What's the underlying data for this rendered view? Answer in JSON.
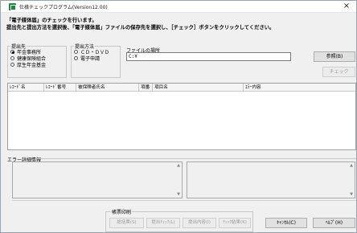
{
  "window": {
    "title": "仕様チェックプログラム(Version12.00)",
    "close_glyph": "×"
  },
  "messages": {
    "line1": "「電子媒体届」のチェックを行います。",
    "line2": "提出先と提出方法を選択後、「電子媒体届」ファイルの保存先を選択し、［チェック］ボタンをクリックしてください。"
  },
  "destination": {
    "legend": "提出先",
    "options": [
      {
        "label": "年金事務所",
        "selected": true
      },
      {
        "label": "健康保険組合",
        "selected": false
      },
      {
        "label": "厚生年金基金",
        "selected": false
      }
    ]
  },
  "method": {
    "legend": "提出方法",
    "options": [
      {
        "label": "ＣＤ・ＤＶＤ",
        "selected": false
      },
      {
        "label": "電子申請",
        "selected": false
      }
    ]
  },
  "file_location": {
    "label": "ファイルの場所",
    "value": "C:¥"
  },
  "buttons": {
    "browse": "参照(B)",
    "check": "チェック"
  },
  "grid": {
    "columns": [
      "ﾚｺｰﾄﾞ名",
      "ﾚｺｰﾄﾞ番号",
      "被保険者氏名",
      "項番",
      "項目名",
      "ｴﾗｰ内容"
    ]
  },
  "error_detail": {
    "label": "エラー詳細情報"
  },
  "scroll": {
    "up": "▲",
    "down": "▼"
  },
  "print": {
    "label": "帳票印刷",
    "buttons": [
      "総括票(S)",
      "提出ﾁｪｯｸ(L)",
      "提出内容(I)",
      "ﾁｪｯｸ結果(K)"
    ]
  },
  "footer": {
    "cancel": "ｷｬﾝｾﾙ(C)",
    "help": "ﾍﾙﾌﾟ(H)"
  }
}
